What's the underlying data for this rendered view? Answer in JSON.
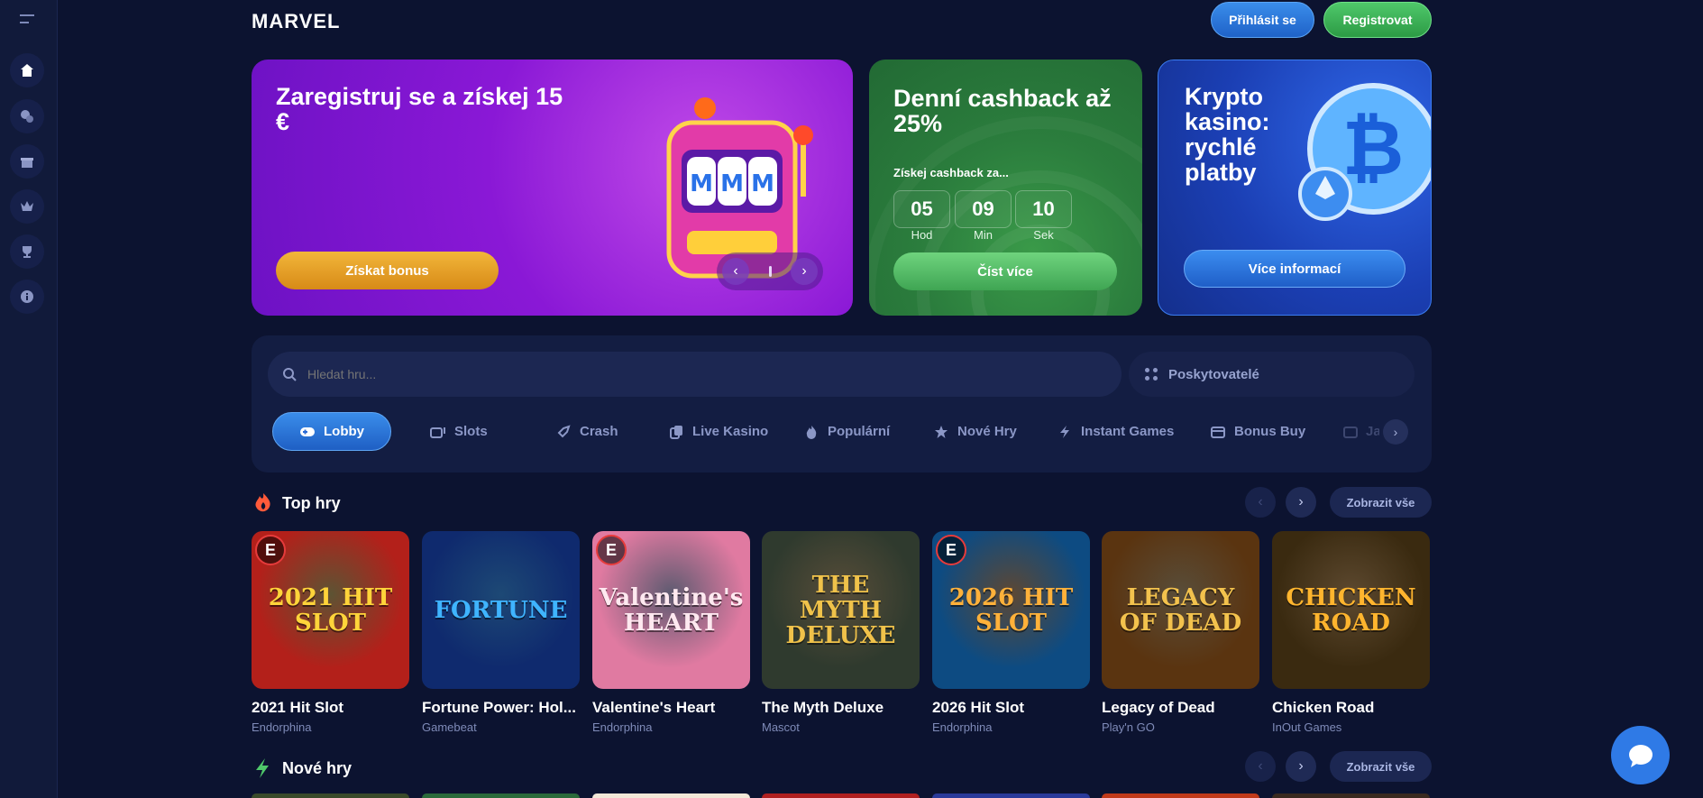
{
  "brand": {
    "logo": "MARVEL"
  },
  "header": {
    "login_label": "Přihlásit se",
    "register_label": "Registrovat"
  },
  "banners": {
    "welcome": {
      "title": "Zaregistruj se a získej 15 €",
      "button": "Získat bonus"
    },
    "cashback": {
      "title": "Denní cashback až 25%",
      "subtitle": "Získej cashback za...",
      "countdown": [
        {
          "value": "05",
          "unit": "Hod"
        },
        {
          "value": "09",
          "unit": "Min"
        },
        {
          "value": "10",
          "unit": "Sek"
        }
      ],
      "button": "Číst více"
    },
    "crypto": {
      "title": "Krypto kasino: rychlé platby",
      "button": "Více informací"
    }
  },
  "search": {
    "placeholder": "Hledat hru...",
    "providers_label": "Poskytovatelé"
  },
  "tabs": [
    {
      "label": "Lobby",
      "icon": "gamepad-icon",
      "active": true
    },
    {
      "label": "Slots",
      "icon": "slots-icon"
    },
    {
      "label": "Crash",
      "icon": "rocket-icon"
    },
    {
      "label": "Live Kasino",
      "icon": "cards-icon"
    },
    {
      "label": "Populární",
      "icon": "fire-icon"
    },
    {
      "label": "Nové Hry",
      "icon": "star-icon"
    },
    {
      "label": "Instant Games",
      "icon": "lightning-icon"
    },
    {
      "label": "Bonus Buy",
      "icon": "wallet-icon"
    },
    {
      "label": "Jac",
      "icon": "jackpot-icon"
    }
  ],
  "sections": {
    "top": {
      "title": "Top hry",
      "show_all": "Zobrazit vše"
    },
    "new": {
      "title": "Nové hry",
      "show_all": "Zobrazit vše"
    }
  },
  "games": [
    {
      "name": "2021 Hit Slot",
      "provider": "Endorphina",
      "art": "2021 HIT SLOT",
      "bg": "#b3201a",
      "fg": "#ffd43a"
    },
    {
      "name": "Fortune Power: Hold & Win",
      "display_name": "Fortune Power: Hol...",
      "provider": "Gamebeat",
      "art": "FORTUNE",
      "bg": "#0f2a6e",
      "fg": "#3fb4ff"
    },
    {
      "name": "Valentine's Heart",
      "provider": "Endorphina",
      "art": "Valentine's HEART",
      "bg": "#e07aa1",
      "fg": "#ffe9f0"
    },
    {
      "name": "The Myth Deluxe",
      "provider": "Mascot",
      "art": "THE MYTH DELUXE",
      "bg": "#2f3a2e",
      "fg": "#f0c24a"
    },
    {
      "name": "2026 Hit Slot",
      "provider": "Endorphina",
      "art": "2026 HIT SLOT",
      "bg": "#0d4b82",
      "fg": "#ffb13a"
    },
    {
      "name": "Legacy of Dead",
      "provider": "Play'n GO",
      "art": "LEGACY OF DEAD",
      "bg": "#5a3410",
      "fg": "#f3c24d"
    },
    {
      "name": "Chicken Road",
      "provider": "InOut Games",
      "art": "CHICKEN ROAD",
      "bg": "#3a2a10",
      "fg": "#ffb52e"
    }
  ]
}
